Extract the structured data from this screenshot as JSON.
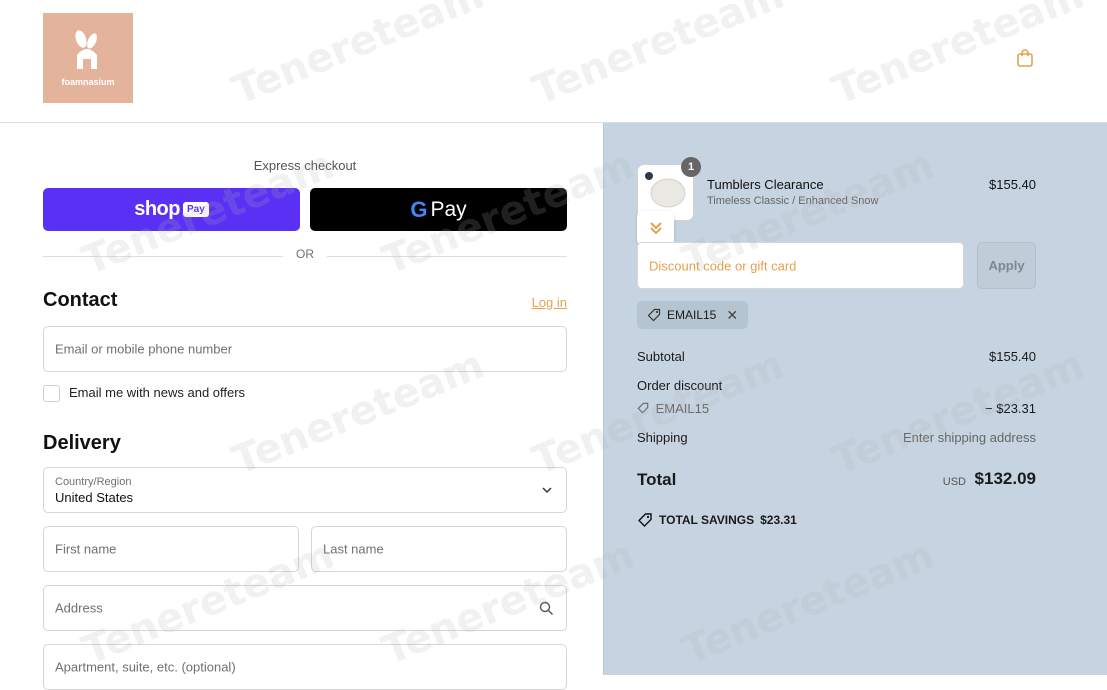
{
  "brand": {
    "logo_text": "foamnasium",
    "logo_color": "#e4b39b"
  },
  "checkout": {
    "express_label": "Express checkout",
    "shop_pay": {
      "word": "shop",
      "badge": "Pay"
    },
    "gpay": {
      "g": "G",
      "label": "Pay"
    },
    "or_text": "OR"
  },
  "contact": {
    "title": "Contact",
    "login_link": "Log in",
    "email_placeholder": "Email or mobile phone number",
    "news_label": "Email me with news and offers"
  },
  "delivery": {
    "title": "Delivery",
    "country_label": "Country/Region",
    "country_value": "United States",
    "first_name_placeholder": "First name",
    "last_name_placeholder": "Last name",
    "address_placeholder": "Address",
    "apartment_placeholder": "Apartment, suite, etc. (optional)"
  },
  "order": {
    "item": {
      "name": "Tumblers Clearance",
      "variant": "Timeless Classic / Enhanced Snow",
      "price": "$155.40",
      "quantity": "1"
    },
    "discount_placeholder": "Discount code or gift card",
    "apply_label": "Apply",
    "applied_code": "EMAIL15",
    "subtotal_label": "Subtotal",
    "subtotal_value": "$155.40",
    "order_discount_label": "Order discount",
    "discount_code": "EMAIL15",
    "discount_value": "− $23.31",
    "shipping_label": "Shipping",
    "shipping_value": "Enter shipping address",
    "total_label": "Total",
    "currency": "USD",
    "total_value": "$132.09",
    "savings_label": "TOTAL SAVINGS",
    "savings_value": "$23.31"
  },
  "watermark": "Tenereteam"
}
